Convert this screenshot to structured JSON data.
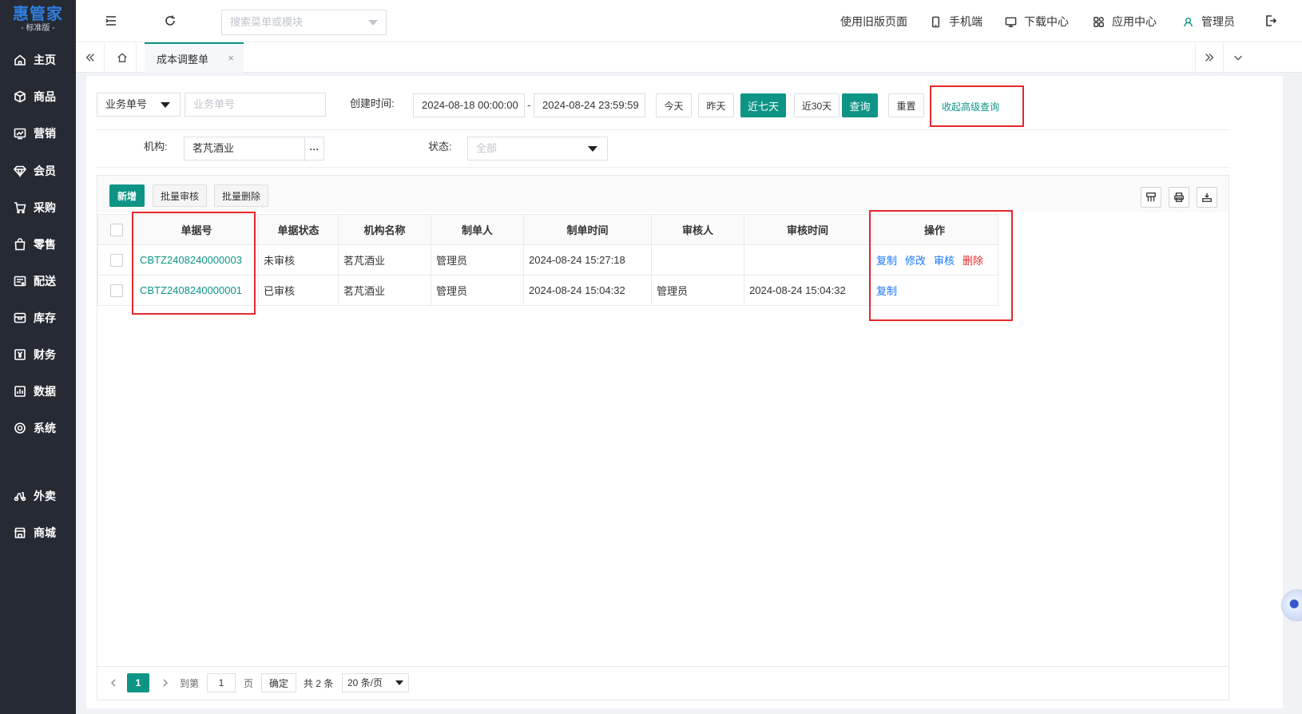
{
  "sidebar": {
    "logo_main": "惠管家",
    "logo_sub": "- 标准版 -",
    "items": [
      {
        "label": "主页",
        "icon": "home-icon"
      },
      {
        "label": "商品",
        "icon": "cube-icon"
      },
      {
        "label": "营销",
        "icon": "chart-trend-icon"
      },
      {
        "label": "会员",
        "icon": "diamond-icon"
      },
      {
        "label": "采购",
        "icon": "cart-icon"
      },
      {
        "label": "零售",
        "icon": "bag-icon"
      },
      {
        "label": "配送",
        "icon": "truck-icon"
      },
      {
        "label": "库存",
        "icon": "warehouse-icon"
      },
      {
        "label": "财务",
        "icon": "yen-icon"
      },
      {
        "label": "数据",
        "icon": "bar-chart-icon"
      },
      {
        "label": "系统",
        "icon": "settings-icon"
      },
      {
        "label": "外卖",
        "icon": "scooter-icon"
      },
      {
        "label": "商城",
        "icon": "store-icon"
      }
    ]
  },
  "topbar": {
    "search_placeholder": "搜索菜单或模块",
    "old_page": "使用旧版页面",
    "mobile": "手机端",
    "download": "下载中心",
    "apps": "应用中心",
    "user": "管理员"
  },
  "tabs": {
    "active": "成本调整单"
  },
  "filters": {
    "field_select": "业务单号",
    "field_input_placeholder": "业务单号",
    "created_label": "创建时间:",
    "date_start": "2024-08-18 00:00:00",
    "date_sep": "-",
    "date_end": "2024-08-24 23:59:59",
    "btn_today": "今天",
    "btn_yesterday": "昨天",
    "btn_7days": "近七天",
    "btn_30days": "近30天",
    "btn_query": "查询",
    "btn_reset": "重置",
    "collapse_adv": "收起高级查询",
    "org_label": "机构:",
    "org_value": "茗芃酒业",
    "status_label": "状态:",
    "status_value": "全部"
  },
  "toolbar": {
    "add": "新增",
    "batch_review": "批量审核",
    "batch_delete": "批量删除"
  },
  "table": {
    "columns": [
      "单据号",
      "单据状态",
      "机构名称",
      "制单人",
      "制单时间",
      "审核人",
      "审核时间",
      "操作"
    ],
    "rows": [
      {
        "doc_no": "CBTZ2408240000003",
        "status": "未审核",
        "org": "茗芃酒业",
        "creator": "管理员",
        "created_at": "2024-08-24 15:27:18",
        "reviewer": "",
        "reviewed_at": "",
        "actions": [
          "复制",
          "修改",
          "审核",
          "删除"
        ]
      },
      {
        "doc_no": "CBTZ2408240000001",
        "status": "已审核",
        "org": "茗芃酒业",
        "creator": "管理员",
        "created_at": "2024-08-24 15:04:32",
        "reviewer": "管理员",
        "reviewed_at": "2024-08-24 15:04:32",
        "actions": [
          "复制"
        ]
      }
    ]
  },
  "pager": {
    "current": "1",
    "goto_label": "到第",
    "goto_value": "1",
    "page_unit": "页",
    "confirm": "确定",
    "total": "共 2 条",
    "page_size": "20 条/页"
  },
  "colors": {
    "primary": "#0e9485",
    "sidebar_bg": "#262a33",
    "link_blue": "#1677ff",
    "danger": "#e5282c",
    "highlight_box": "#e5282c"
  }
}
